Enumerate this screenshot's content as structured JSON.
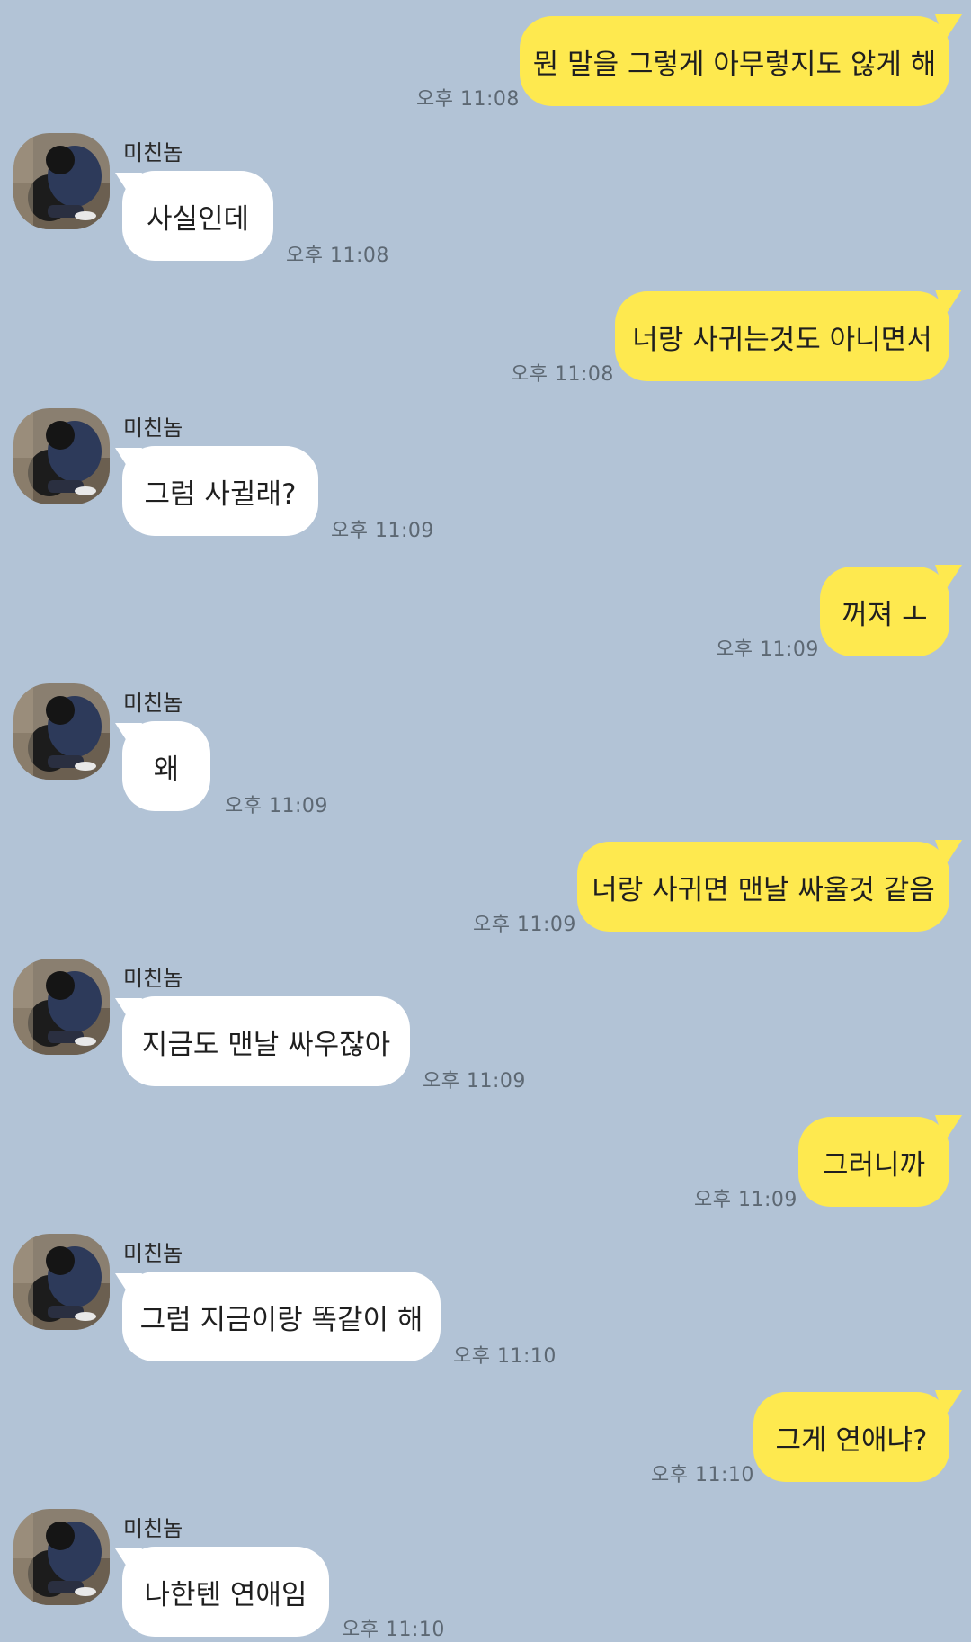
{
  "chat": {
    "messages": [
      {
        "from": "me",
        "text": "뭔 말을 그렇게 아무렇지도 않게 해",
        "time": "오후 11:08"
      },
      {
        "from": "them",
        "sender": "미친놈",
        "text": "사실인데",
        "time": "오후 11:08"
      },
      {
        "from": "me",
        "text": "너랑 사귀는것도 아니면서",
        "time": "오후 11:08"
      },
      {
        "from": "them",
        "sender": "미친놈",
        "text": "그럼 사귈래?",
        "time": "오후 11:09"
      },
      {
        "from": "me",
        "text": "꺼져 ㅗ",
        "time": "오후 11:09"
      },
      {
        "from": "them",
        "sender": "미친놈",
        "text": "왜",
        "time": "오후 11:09"
      },
      {
        "from": "me",
        "text": "너랑 사귀면 맨날 싸울것 같음",
        "time": "오후 11:09"
      },
      {
        "from": "them",
        "sender": "미친놈",
        "text": "지금도 맨날 싸우잖아",
        "time": "오후 11:09"
      },
      {
        "from": "me",
        "text": "그러니까",
        "time": "오후 11:09"
      },
      {
        "from": "them",
        "sender": "미친놈",
        "text": "그럼 지금이랑 똑같이 해",
        "time": "오후 11:10"
      },
      {
        "from": "me",
        "text": "그게 연애냐?",
        "time": "오후 11:10"
      },
      {
        "from": "them",
        "sender": "미친놈",
        "text": "나한텐 연애임",
        "time": "오후 11:10"
      }
    ]
  },
  "icons": {
    "avatar": "profile-photo-avatar"
  },
  "colors": {
    "background": "#b2c3d6",
    "my_bubble": "#fee94f",
    "their_bubble": "#ffffff",
    "timestamp": "#5d6873"
  }
}
